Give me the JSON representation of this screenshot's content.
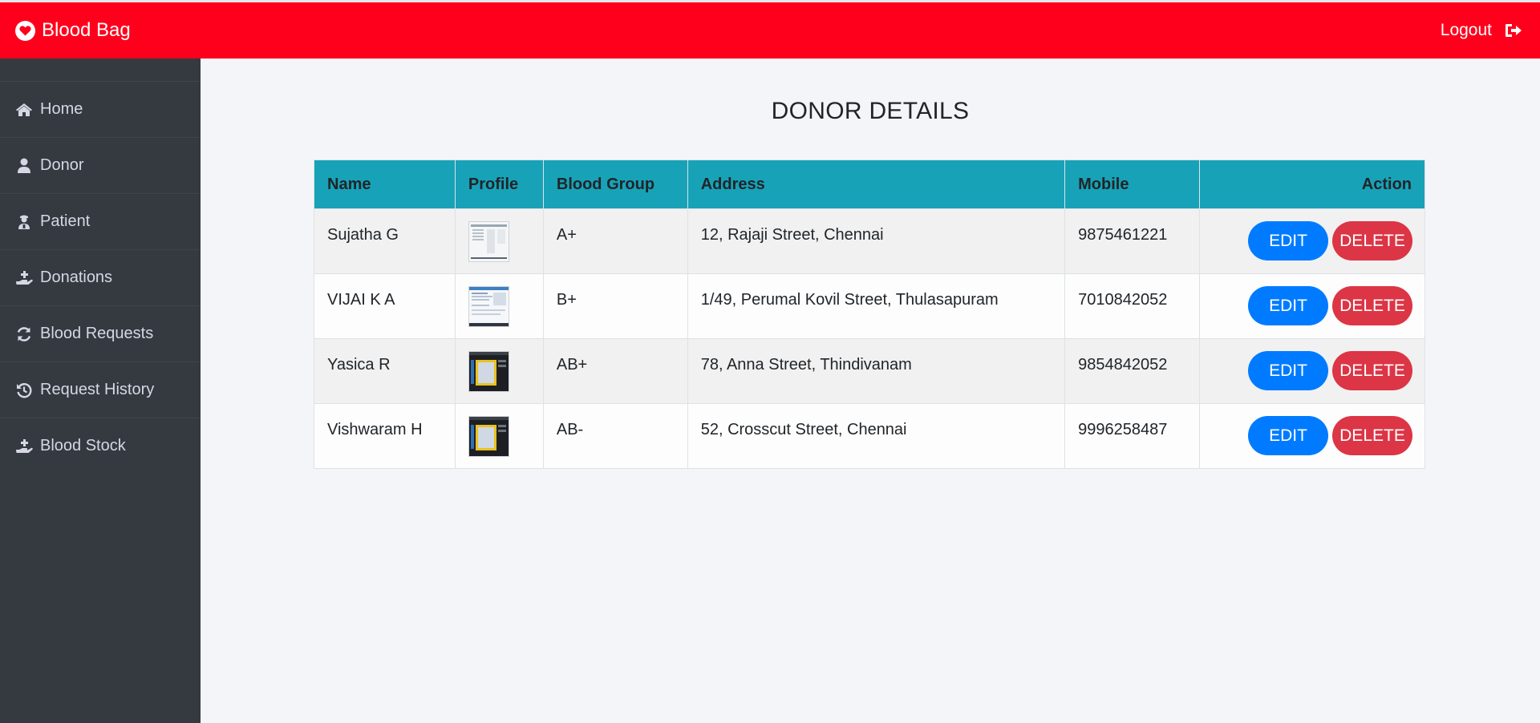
{
  "brand": {
    "name": "Blood Bag",
    "icon": "heart-icon",
    "color": "#ff001c"
  },
  "header": {
    "logout_label": "Logout",
    "logout_icon": "sign-out-icon"
  },
  "sidebar": {
    "items": [
      {
        "label": "Home",
        "icon": "home-icon"
      },
      {
        "label": "Donor",
        "icon": "user-icon"
      },
      {
        "label": "Patient",
        "icon": "patient-icon"
      },
      {
        "label": "Donations",
        "icon": "hand-holding-medical-icon"
      },
      {
        "label": "Blood Requests",
        "icon": "sync-icon"
      },
      {
        "label": "Request History",
        "icon": "history-icon"
      },
      {
        "label": "Blood Stock",
        "icon": "hand-holding-medical-icon"
      }
    ]
  },
  "main": {
    "title": "DONOR DETAILS",
    "table": {
      "headers": [
        "Name",
        "Profile",
        "Blood Group",
        "Address",
        "Mobile",
        "Action"
      ],
      "rows": [
        {
          "name": "Sujatha G",
          "profile": "document-screenshot",
          "blood_group": "A+",
          "address": "12, Rajaji Street, Chennai",
          "mobile": "9875461221",
          "edit": "EDIT",
          "delete": "DELETE"
        },
        {
          "name": "VIJAI K A",
          "profile": "document-screenshot",
          "blood_group": "B+",
          "address": "1/49, Perumal Kovil Street, Thulasapuram",
          "mobile": "7010842052",
          "edit": "EDIT",
          "delete": "DELETE"
        },
        {
          "name": "Yasica R",
          "profile": "dark-screenshot",
          "blood_group": "AB+",
          "address": "78, Anna Street, Thindivanam",
          "mobile": "9854842052",
          "edit": "EDIT",
          "delete": "DELETE"
        },
        {
          "name": "Vishwaram H",
          "profile": "dark-screenshot",
          "blood_group": "AB-",
          "address": "52, Crosscut Street, Chennai",
          "mobile": "9996258487",
          "edit": "EDIT",
          "delete": "DELETE"
        }
      ]
    },
    "colors": {
      "header_bg": "#17a2b8",
      "edit": "#007bff",
      "delete": "#dc3545"
    }
  }
}
